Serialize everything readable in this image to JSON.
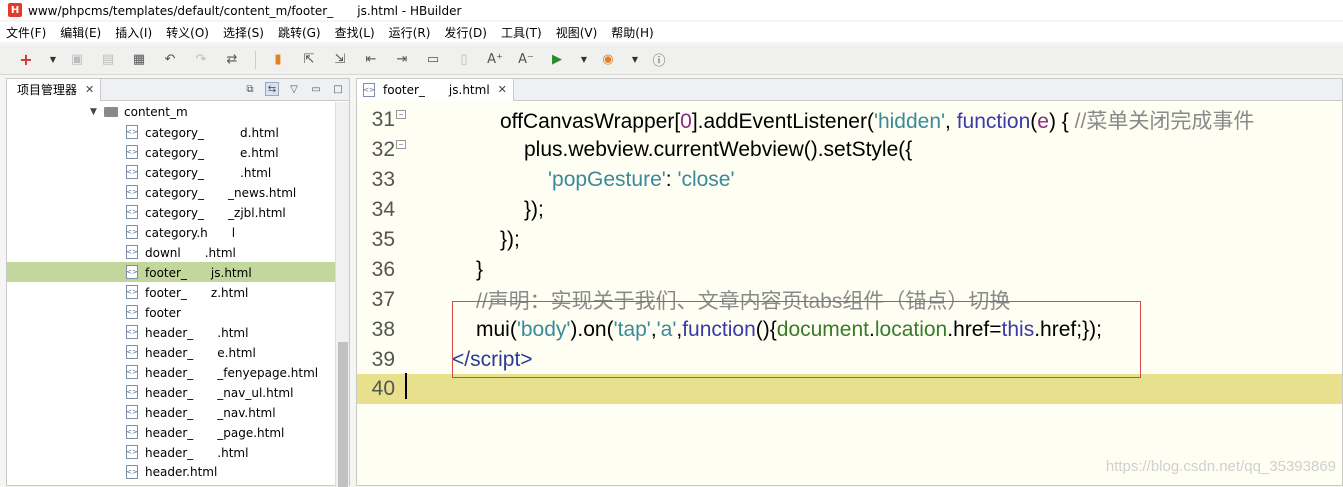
{
  "window": {
    "title": "www/phpcms/templates/default/content_m/footer_　　js.html  -  HBuilder",
    "logo": "H"
  },
  "menu": [
    "文件(F)",
    "编辑(E)",
    "插入(I)",
    "转义(O)",
    "选择(S)",
    "跳转(G)",
    "查找(L)",
    "运行(R)",
    "发行(D)",
    "工具(T)",
    "视图(V)",
    "帮助(H)"
  ],
  "explorer": {
    "tab_label": "项目管理器",
    "folder": "content_m",
    "files": [
      {
        "name": "category_　　　d.html",
        "selected": false
      },
      {
        "name": "category_　　　e.html",
        "selected": false
      },
      {
        "name": "category_　　　.html",
        "selected": false
      },
      {
        "name": "category_　　_news.html",
        "selected": false
      },
      {
        "name": "category_　　_zjbl.html",
        "selected": false
      },
      {
        "name": "category.h　　l",
        "selected": false
      },
      {
        "name": "downl　　.html",
        "selected": false
      },
      {
        "name": "footer_　　js.html",
        "selected": true
      },
      {
        "name": "footer_　　z.html",
        "selected": false
      },
      {
        "name": "footer　　　",
        "selected": false
      },
      {
        "name": "header_　　.html",
        "selected": false
      },
      {
        "name": "header_　　e.html",
        "selected": false
      },
      {
        "name": "header_　　_fenyepage.html",
        "selected": false
      },
      {
        "name": "header_　　_nav_ul.html",
        "selected": false
      },
      {
        "name": "header_　　_nav.html",
        "selected": false
      },
      {
        "name": "header_　　_page.html",
        "selected": false
      },
      {
        "name": "header_　　.html",
        "selected": false
      },
      {
        "name": "header.html",
        "selected": false
      }
    ]
  },
  "editor": {
    "tab_label": "footer_　　js.html",
    "lines": [
      {
        "num": "31",
        "fold": true
      },
      {
        "num": "32",
        "fold": true
      },
      {
        "num": "33",
        "fold": false
      },
      {
        "num": "34",
        "fold": false
      },
      {
        "num": "35",
        "fold": false
      },
      {
        "num": "36",
        "fold": false
      },
      {
        "num": "37",
        "fold": false
      },
      {
        "num": "38",
        "fold": false
      },
      {
        "num": "39",
        "fold": false
      },
      {
        "num": "40",
        "fold": false
      }
    ],
    "code": {
      "l31_a": "offCanvasWrapper[",
      "l31_b": "0",
      "l31_c": "].addEventListener(",
      "l31_d": "'hidden'",
      "l31_e": ", ",
      "l31_f": "function",
      "l31_g": "(",
      "l31_h": "e",
      "l31_i": ") { ",
      "l31_j": "//菜单关闭完成事件",
      "l32": "plus.webview.currentWebview().setStyle({",
      "l33_a": "'popGesture'",
      "l33_b": ": ",
      "l33_c": "'close'",
      "l34": "});",
      "l35": "});",
      "l36": "}",
      "l37": "//声明：实现关于我们、文章内容页tabs组件（锚点）切换",
      "l38_a": "mui(",
      "l38_b": "'body'",
      "l38_c": ").on(",
      "l38_d": "'tap'",
      "l38_e": ",",
      "l38_f": "'a'",
      "l38_g": ",",
      "l38_h": "function",
      "l38_i": "(){",
      "l38_j": "document",
      "l38_k": ".",
      "l38_l": "location",
      "l38_m": ".href=",
      "l38_n": "this",
      "l38_o": ".href;});",
      "l39_a": "</",
      "l39_b": "script",
      "l39_c": ">"
    }
  },
  "watermark": "https://blog.csdn.net/qq_35393869"
}
